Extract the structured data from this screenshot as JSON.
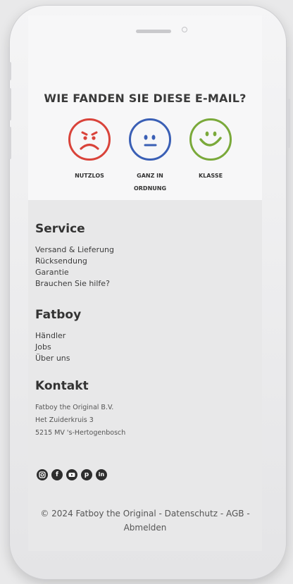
{
  "survey": {
    "title": "WIE FANDEN SIE DIESE E-MAIL?",
    "options": [
      {
        "label": "NUTZLOS",
        "color": "#d9433a"
      },
      {
        "label": "GANZ IN",
        "label2": "ORDNUNG",
        "color": "#3a5fb5"
      },
      {
        "label": "KLASSE",
        "color": "#7aa93a"
      }
    ]
  },
  "service": {
    "heading": "Service",
    "links": [
      "Versand & Lieferung",
      "Rücksendung",
      "Garantie",
      "Brauchen Sie hilfe?"
    ]
  },
  "fatboy": {
    "heading": "Fatboy",
    "links": [
      "Händler",
      "Jobs",
      "Über uns"
    ]
  },
  "kontakt": {
    "heading": "Kontakt",
    "address": [
      "Fatboy the Original B.V.",
      "Het Zuiderkruis 3",
      "5215 MV 's-Hertogenbosch"
    ]
  },
  "social_icons": [
    "instagram-icon",
    "facebook-icon",
    "youtube-icon",
    "pinterest-icon",
    "linkedin-icon"
  ],
  "footer": {
    "copyright_line1": "© 2024 Fatboy the Original - Datenschutz - AGB -",
    "copyright_line2": "Abmelden"
  }
}
